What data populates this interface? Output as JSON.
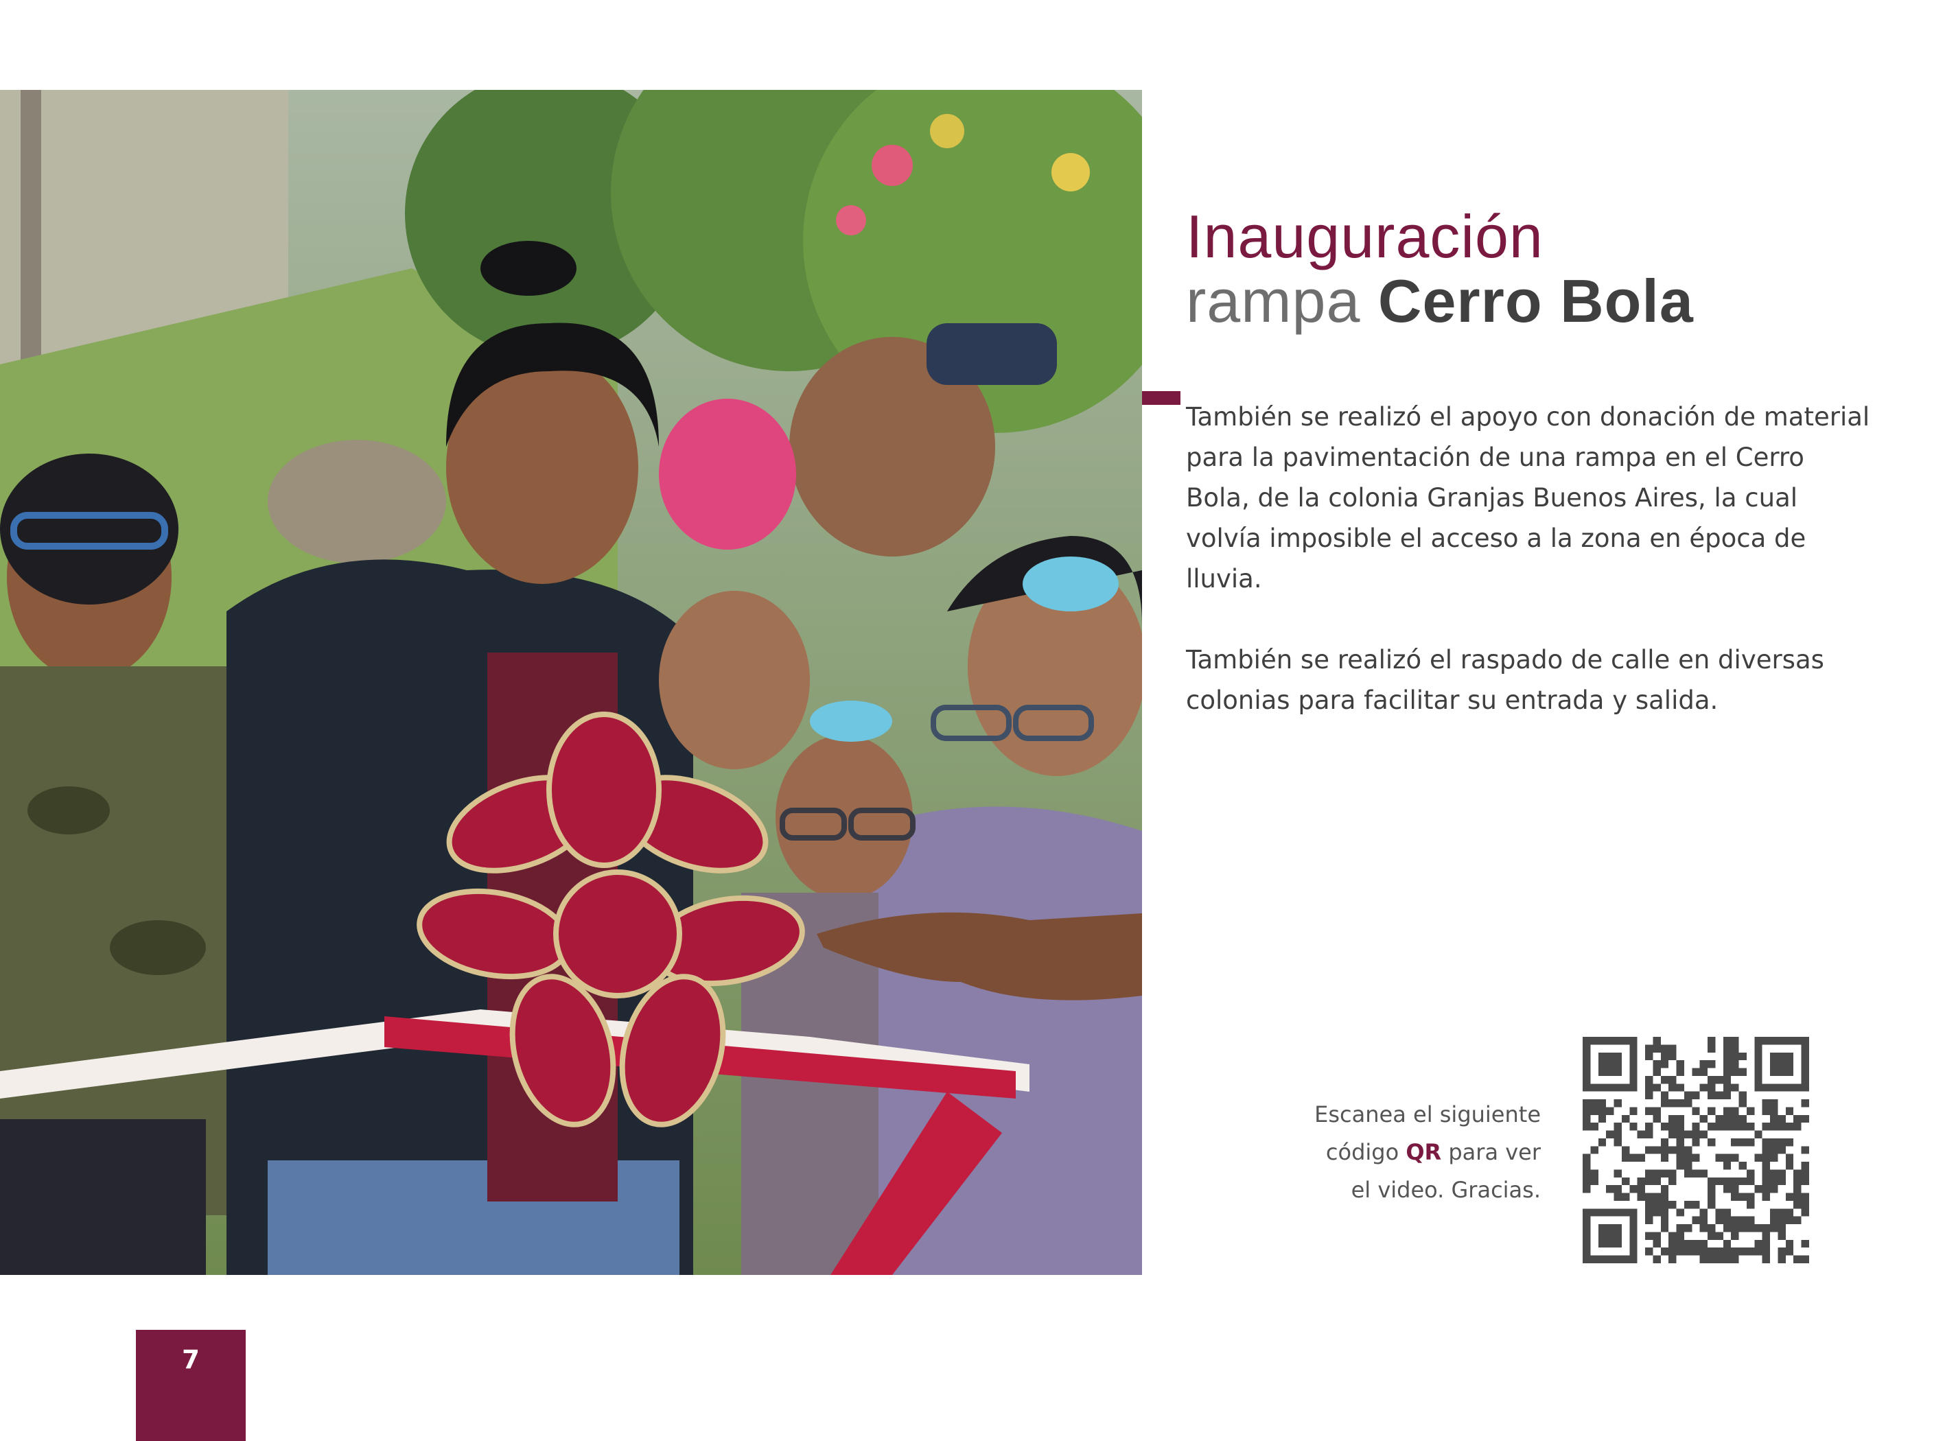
{
  "photo": {
    "alt": "",
    "icon": "photo-ribbon-cutting"
  },
  "title": {
    "line1": "Inauguración",
    "line2_light": "rampa",
    "line2_bold": "Cerro Bola"
  },
  "body": {
    "paragraph1": "También se realizó el apoyo con donación de material para la pavimentación de una rampa en el Cerro Bola, de la colonia Granjas Buenos Aires, la cual volvía imposible el acceso a la zona en época de lluvia.",
    "paragraph2": "También se realizó el raspado de calle en diversas colonias para facilitar su entrada y salida."
  },
  "qr_note": {
    "line1": "Escanea el siguiente",
    "line2_pre": "código",
    "line2_qr": "QR",
    "line2_post": "para ver",
    "line3": "el video. Gracias.",
    "icon": "qr-code-icon"
  },
  "page": {
    "number": "7"
  },
  "colors": {
    "accent": "#7b1a40",
    "text": "#3f3f3f",
    "qr": "#4a4a4a"
  }
}
